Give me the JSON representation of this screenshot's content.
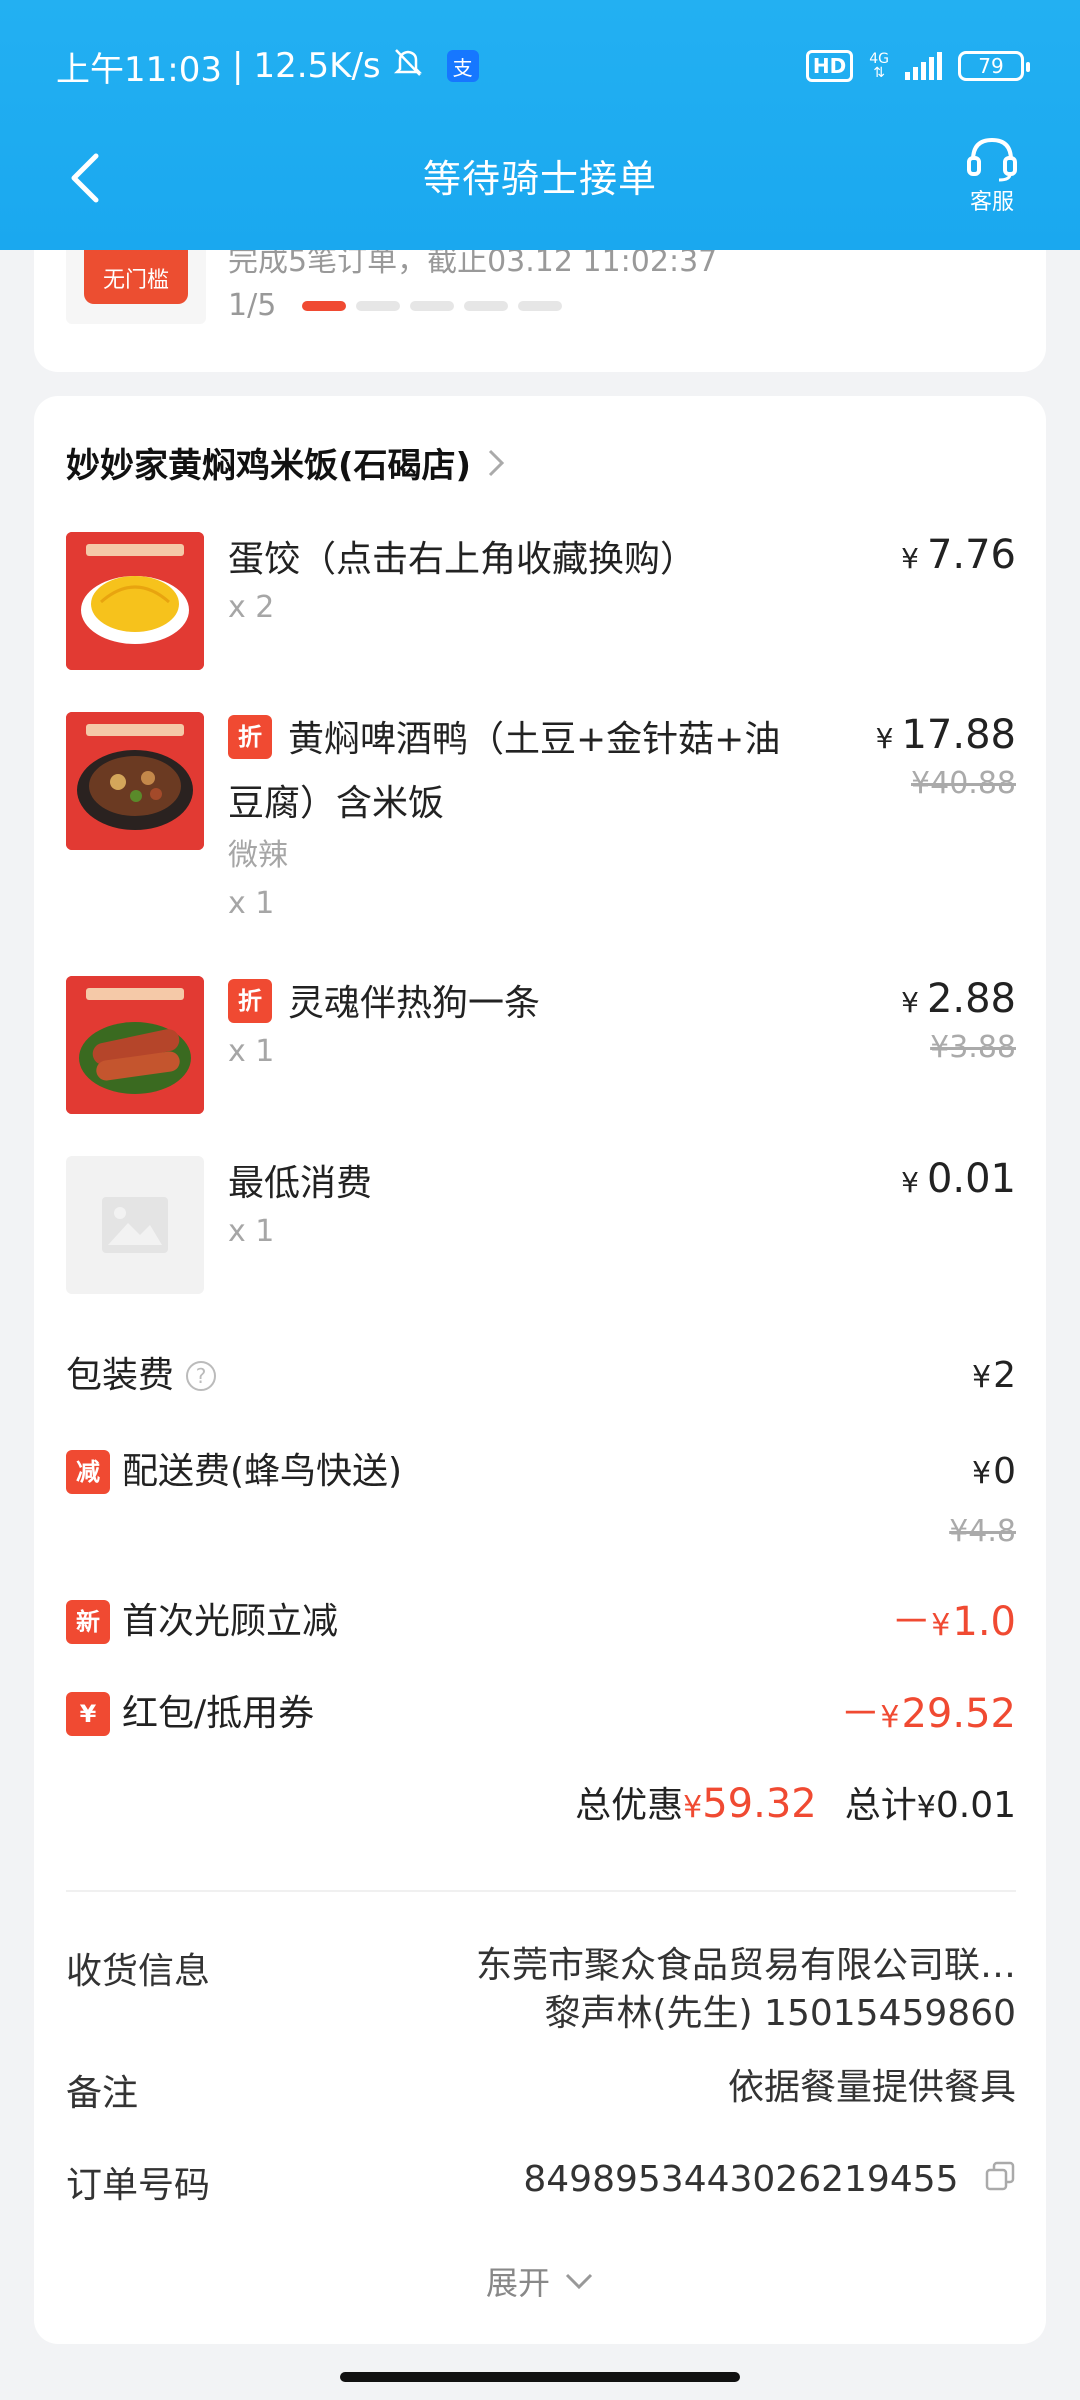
{
  "status_bar": {
    "time": "上午11:03",
    "speed": "12.5K/s",
    "hd": "HD",
    "network": "4G",
    "battery": "79"
  },
  "nav": {
    "title": "等待骑士接单",
    "service_label": "客服"
  },
  "top_card": {
    "badge": "无门槛",
    "info": "完成5笔订单，截止03.12 11:02:37",
    "page": "1/5"
  },
  "shop": {
    "name": "妙妙家黄焖鸡米饭(石碣店)"
  },
  "items": [
    {
      "name": "蛋饺（点击右上角收藏换购）",
      "qty": "x 2",
      "price": "7.76",
      "original": "",
      "tag": "",
      "spec": ""
    },
    {
      "name": "黄焖啤酒鸭（土豆+金针菇+油豆腐）含米饭",
      "qty": "x 1",
      "price": "17.88",
      "original": "¥40.88",
      "tag": "折",
      "spec": "微辣"
    },
    {
      "name": "灵魂伴热狗一条",
      "qty": "x 1",
      "price": "2.88",
      "original": "¥3.88",
      "tag": "折",
      "spec": ""
    },
    {
      "name": "最低消费",
      "qty": "x 1",
      "price": "0.01",
      "original": "",
      "tag": "",
      "spec": ""
    }
  ],
  "currency": "¥",
  "fees": {
    "packaging_label": "包装费",
    "packaging_value": "2",
    "delivery_tag": "减",
    "delivery_label": "配送费(蜂鸟快送)",
    "delivery_value": "0",
    "delivery_original": "¥4.8",
    "first_visit_tag": "新",
    "first_visit_label": "首次光顾立减",
    "first_visit_value": "1.0",
    "coupon_tag": "¥",
    "coupon_label": "红包/抵用券",
    "coupon_value": "29.52",
    "minus": "－"
  },
  "summary": {
    "discount_label": "总优惠",
    "discount_value": "59.32",
    "total_label": "总计",
    "total_value": "0.01"
  },
  "delivery_info": {
    "label": "收货信息",
    "address": "东莞市聚众食品贸易有限公司联…",
    "contact": "黎声林(先生) 15015459860"
  },
  "note": {
    "label": "备注",
    "value": "依据餐量提供餐具"
  },
  "order": {
    "label": "订单号码",
    "value": "8498953443026219455"
  },
  "expand_label": "展开",
  "colors": {
    "header": "#1aa8ef",
    "accent_red": "#f04a32"
  }
}
